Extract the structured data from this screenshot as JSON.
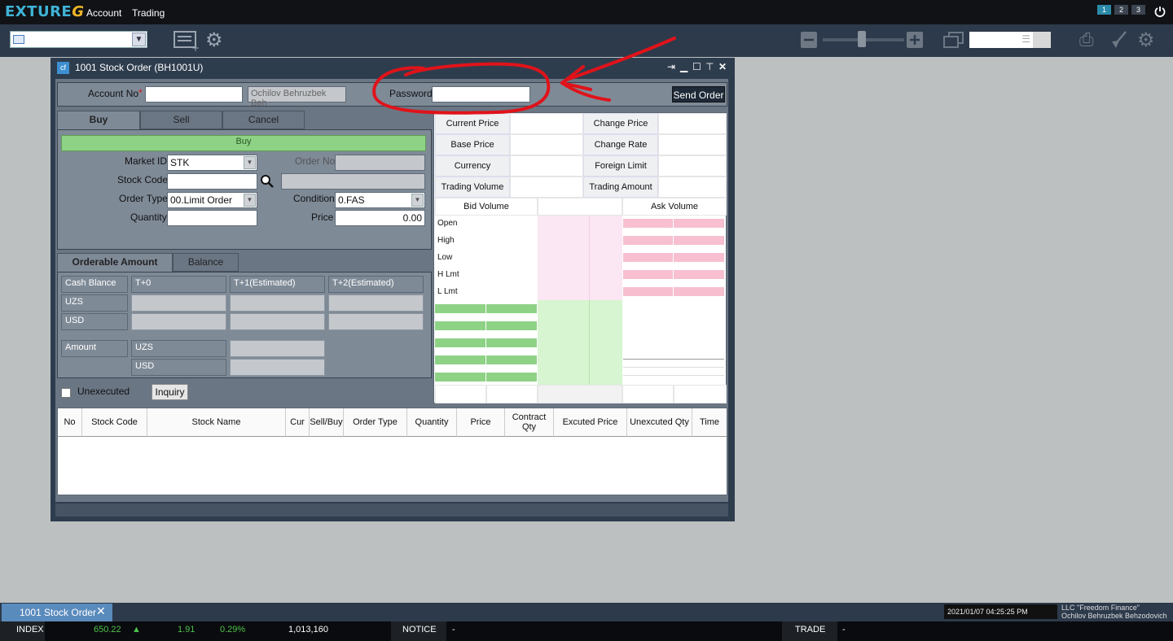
{
  "app": {
    "logo": "EXTURE",
    "logo_suffix": "G"
  },
  "menubar": {
    "items": [
      "Account",
      "Trading"
    ],
    "workspaces": [
      "1",
      "2",
      "3"
    ]
  },
  "window": {
    "title": "1001 Stock Order (BH1001U)",
    "icon": "cf"
  },
  "order_header": {
    "account_label": "Account No",
    "required_mark": "*",
    "account_value": "",
    "account_name": "Ochilov Behruzbek Beh",
    "password_label": "Password",
    "password_value": "",
    "send_button": "Send Order"
  },
  "order_tabs": [
    "Buy",
    "Sell",
    "Cancel"
  ],
  "buy_banner": "Buy",
  "order_form": {
    "market_id_label": "Market ID",
    "market_id_value": "STK",
    "order_no_label": "Order No",
    "stock_code_label": "Stock Code",
    "order_type_label": "Order Type",
    "order_type_value": "00.Limit Order",
    "condition_label": "Condition",
    "condition_value": "0.FAS",
    "quantity_label": "Quantity",
    "price_label": "Price",
    "price_value": "0.00"
  },
  "amount_tabs": [
    "Orderable Amount",
    "Balance"
  ],
  "amount_table": {
    "headers": [
      "Cash Blance",
      "T+0",
      "T+1(Estimated)",
      "T+2(Estimated)"
    ],
    "rows": [
      "UZS",
      "USD"
    ],
    "amount_label": "Amount",
    "amount_rows": [
      "UZS",
      "USD"
    ]
  },
  "unexecuted": {
    "label": "Unexecuted",
    "inquiry_button": "Inquiry"
  },
  "quote": {
    "labels_left": [
      "Current Price",
      "Base Price",
      "Currency",
      "Trading Volume"
    ],
    "labels_right": [
      "Change Price",
      "Change Rate",
      "Foreign Limit",
      "Trading Amount"
    ],
    "bid_header": "Bid Volume",
    "ask_header": "Ask Volume",
    "ohl": [
      "Open",
      "High",
      "Low",
      "H Lmt",
      "L Lmt"
    ]
  },
  "grid": {
    "columns": [
      "No",
      "Stock Code",
      "Stock Name",
      "Cur",
      "Sell/Buy",
      "Order Type",
      "Quantity",
      "Price",
      "Contract Qty",
      "Excuted Price",
      "Unexcuted Qty",
      "Time"
    ]
  },
  "taskbar": {
    "tab_label": "1001 Stock Order",
    "clock": "2021/01/07 04:25:25 PM",
    "company_line1": "LLC \"Freedom Finance\"",
    "company_line2": "Ochilov Behruzbek Behzodovich"
  },
  "ticker": {
    "index_label": "INDEX",
    "index_value": "650.22",
    "change": "1.91",
    "change_pct": "0.29%",
    "volume": "1,013,160",
    "notice_label": "NOTICE",
    "notice_value": "-",
    "trade_label": "TRADE",
    "trade_value": "-"
  },
  "colors": {
    "annotation": "#e0131a",
    "accent": "#3fb3d6",
    "buy_green": "#8ed286",
    "ask_pink": "#f7bfd0",
    "up_green": "#4fc14c"
  }
}
